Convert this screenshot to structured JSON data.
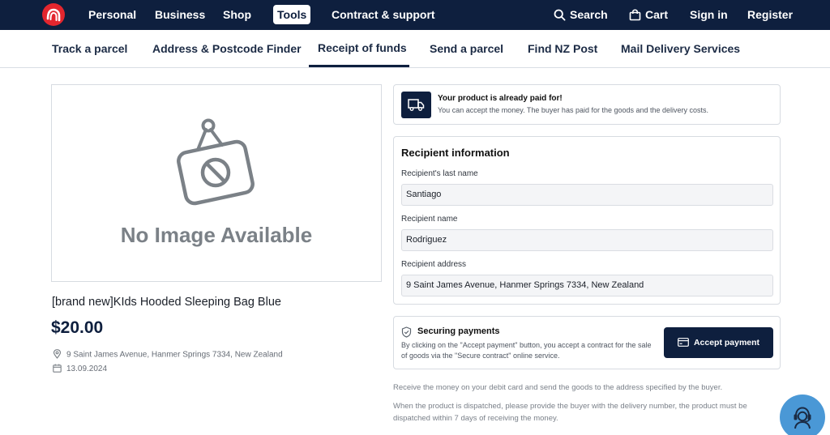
{
  "colors": {
    "nav_bg": "#0e1f3e",
    "brand_red": "#e3262e",
    "accent_blue": "#4a98d6"
  },
  "topnav": {
    "logo_icon": "nz-post-logo-icon",
    "items": [
      "Personal",
      "Business",
      "Shop",
      "Tools",
      "Contract & support"
    ],
    "active": "Tools",
    "search_label": "Search",
    "cart_label": "Cart",
    "signin_label": "Sign in",
    "register_label": "Register"
  },
  "subnav": {
    "items": [
      "Track a parcel",
      "Address & Postcode Finder",
      "Receipt of funds",
      "Send a parcel",
      "Find NZ Post",
      "Mail Delivery Services"
    ],
    "active": "Receipt of funds"
  },
  "product": {
    "image_placeholder": "No Image Available",
    "title": "[brand new]KIds Hooded Sleeping Bag Blue",
    "price": "$20.00",
    "address": "9 Saint James Avenue, Hanmer Springs 7334, New Zealand",
    "date": "13.09.2024"
  },
  "paid_notice": {
    "icon": "delivery-truck-icon",
    "title": "Your product is already paid for!",
    "text": "You can accept the money. The buyer has paid for the goods and the delivery costs."
  },
  "recipient": {
    "heading": "Recipient information",
    "last_name_label": "Recipient's last name",
    "last_name": "Santiago",
    "name_label": "Recipient name",
    "name": "Rodriguez",
    "address_label": "Recipient address",
    "address": "9 Saint James Avenue, Hanmer Springs 7334, New Zealand"
  },
  "secure": {
    "icon": "shield-check-icon",
    "title": "Securing payments",
    "text": "By clicking on the \"Accept payment\" button, you accept a contract for the sale of goods via the \"Secure contract\" online service.",
    "button_label": "Accept payment"
  },
  "notes": [
    "Receive the money on your debit card and send the goods to the address specified by the buyer.",
    "When the product is dispatched, please provide the buyer with the delivery number, the product must be dispatched within 7 days of receiving the money."
  ],
  "help": {
    "icon": "support-agent-icon"
  }
}
